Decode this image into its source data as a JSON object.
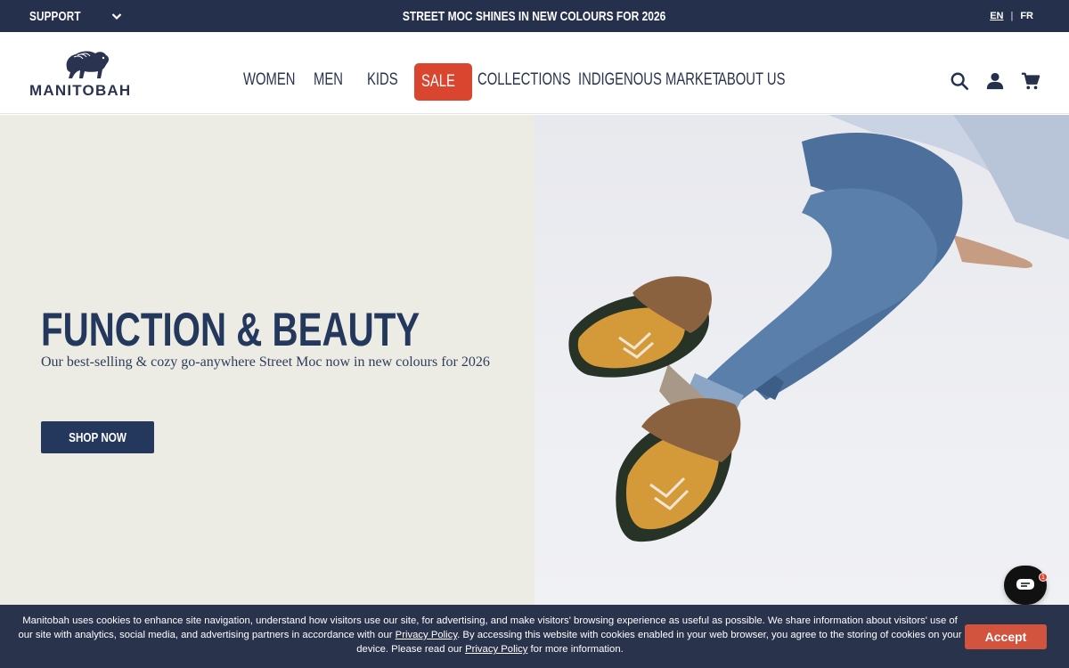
{
  "topbar": {
    "support_label": "SUPPORT",
    "promo_text": "STREET MOC SHINES IN NEW COLOURS FOR 2026",
    "lang_en": "EN",
    "lang_sep": "|",
    "lang_fr": "FR"
  },
  "header": {
    "logo_text": "MANITOBAH",
    "nav": {
      "women": "WOMEN",
      "men": "MEN",
      "kids": "KIDS",
      "sale": "SALE",
      "collections": "COLLECTIONS",
      "indigenous_market": "INDIGENOUS MARKET",
      "about_us": "ABOUT US"
    },
    "icons": [
      "search-icon",
      "account-icon",
      "cart-icon"
    ]
  },
  "hero": {
    "title": "FUNCTION & BEAUTY",
    "subtitle": "Our best-selling & cozy go-anywhere Street Moc now in new colours for 2026",
    "cta": "SHOP NOW"
  },
  "chat": {
    "badge": "1"
  },
  "cookie": {
    "text_1": "Manitobah uses cookies to enhance site navigation, understand how visitors use our site, for advertising, and make visitors' browsing experience as useful as possible. We share information about visitors' use of our site with analytics, social media, and advertising partners in accordance with our ",
    "link_1": "Privacy Policy",
    "text_2": ". By accessing this website with cookies enabled in your web browser, you agree to the storing of cookies on your device. Please read our ",
    "link_2": "Privacy Policy",
    "text_3": " for more information.",
    "accept": "Accept"
  },
  "colors": {
    "navy": "#25304d",
    "hero_navy": "#24385e",
    "sale_red": "#d9452e",
    "accept_red": "#d3543e",
    "hero_bg": "#ecebe4"
  }
}
